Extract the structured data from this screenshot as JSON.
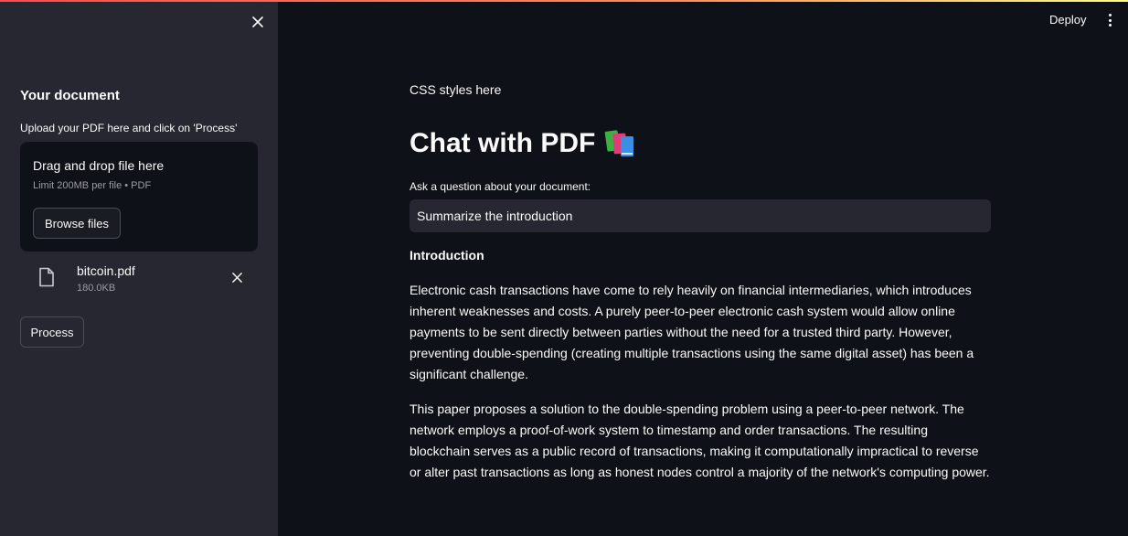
{
  "sidebar": {
    "title": "Your document",
    "upload_label": "Upload your PDF here and click on 'Process'",
    "dropzone": {
      "title": "Drag and drop file here",
      "limit": "Limit 200MB per file • PDF",
      "browse_label": "Browse files"
    },
    "file": {
      "name": "bitcoin.pdf",
      "size": "180.0KB"
    },
    "process_label": "Process"
  },
  "header": {
    "deploy_label": "Deploy"
  },
  "main": {
    "css_note": "CSS styles here",
    "title": "Chat with PDF",
    "title_emoji": "📚",
    "question_label": "Ask a question about your document:",
    "question_value": "Summarize the introduction",
    "answer_heading": "Introduction",
    "paragraphs": [
      "Electronic cash transactions have come to rely heavily on financial intermediaries, which introduces inherent weaknesses and costs. A purely peer-to-peer electronic cash system would allow online payments to be sent directly between parties without the need for a trusted third party. However, preventing double-spending (creating multiple transactions using the same digital asset) has been a significant challenge.",
      "This paper proposes a solution to the double-spending problem using a peer-to-peer network. The network employs a proof-of-work system to timestamp and order transactions. The resulting blockchain serves as a public record of transactions, making it computationally impractical to reverse or alter past transactions as long as honest nodes control a majority of the network's computing power."
    ]
  },
  "colors": {
    "app_bg": "#0e1117",
    "sidebar_bg": "#262730",
    "input_bg": "#262730",
    "text": "#fafafa",
    "muted_text": "#9b9ca3",
    "accent_gradient_start": "#ff4b4b",
    "accent_gradient_end": "#fffd80"
  },
  "icons": {
    "close_sidebar": "close-icon",
    "file": "file-icon",
    "remove_file": "close-icon",
    "menu": "kebab-menu-icon"
  }
}
